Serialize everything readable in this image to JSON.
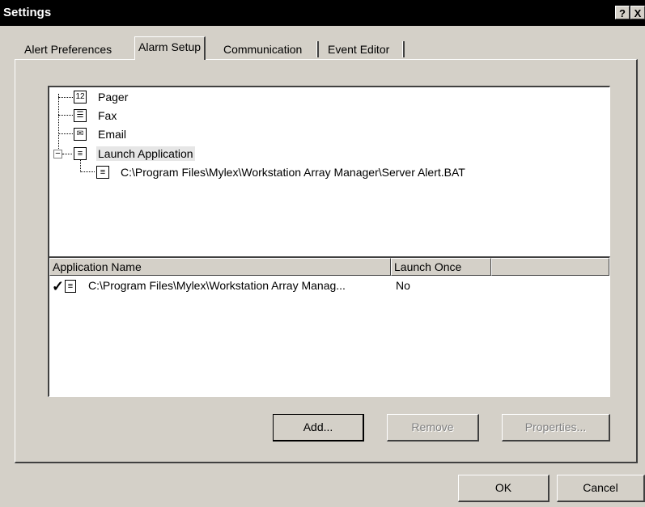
{
  "window": {
    "title": "Settings",
    "help_glyph": "?",
    "close_glyph": "X"
  },
  "tabs": [
    {
      "label": "Alert Preferences"
    },
    {
      "label": "Alarm Setup"
    },
    {
      "label": "Communication"
    },
    {
      "label": "Event Editor"
    }
  ],
  "tree": {
    "items": [
      {
        "label": "Pager",
        "icon": "pager-icon"
      },
      {
        "label": "Fax",
        "icon": "fax-icon"
      },
      {
        "label": "Email",
        "icon": "email-icon"
      },
      {
        "label": "Launch Application",
        "icon": "application-icon"
      }
    ],
    "child": {
      "label": "C:\\Program Files\\Mylex\\Workstation Array Manager\\Server Alert.BAT",
      "icon": "application-icon"
    },
    "expander_glyph": "−"
  },
  "list": {
    "columns": [
      "Application Name",
      "Launch Once"
    ],
    "rows": [
      {
        "check": "✓",
        "name": "C:\\Program Files\\Mylex\\Workstation Array Manag...",
        "launch_once": "No"
      }
    ]
  },
  "buttons": {
    "add": "Add...",
    "remove": "Remove",
    "properties": "Properties...",
    "ok": "OK",
    "cancel": "Cancel"
  }
}
